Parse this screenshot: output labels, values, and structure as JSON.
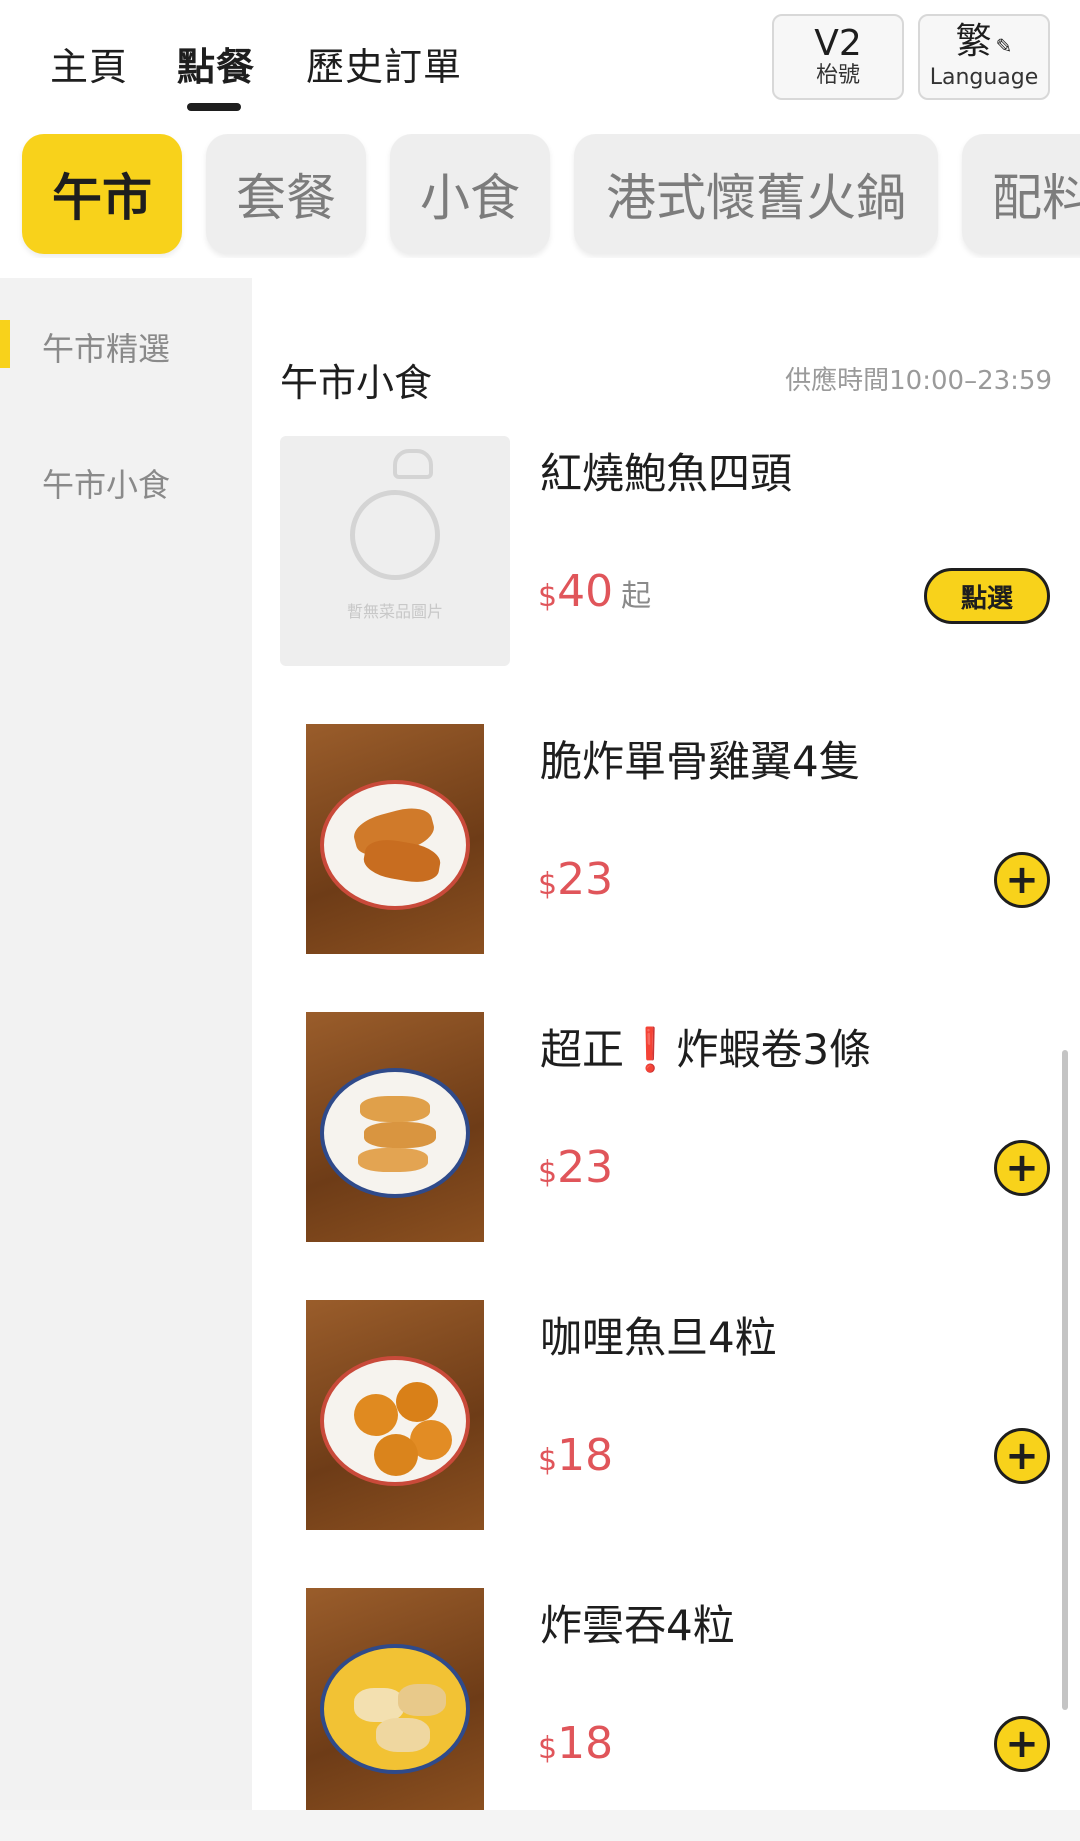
{
  "nav": {
    "tabs": [
      {
        "label": "主頁"
      },
      {
        "label": "點餐"
      },
      {
        "label": "歷史訂單"
      }
    ],
    "table_button": {
      "big": "V2",
      "small": "枱號"
    },
    "language_button": {
      "big": "繁",
      "small": "Language",
      "icon": "pencil-icon"
    }
  },
  "categories": [
    {
      "label": "午市",
      "active": true
    },
    {
      "label": "套餐"
    },
    {
      "label": "小食"
    },
    {
      "label": "港式懷舊火鍋"
    },
    {
      "label": "配料"
    }
  ],
  "sidebar": {
    "items": [
      {
        "label": "午市精選",
        "active": true
      },
      {
        "label": "午市小食"
      }
    ]
  },
  "section": {
    "title": "午市小食",
    "time": "供應時間10:00–23:59"
  },
  "items": [
    {
      "name": "紅燒鮑魚四頭",
      "currency": "$",
      "price": "40",
      "suffix": "起",
      "action": "點選",
      "placeholder_text": "暫無菜品圖片"
    },
    {
      "name": "脆炸單骨雞翼4隻",
      "currency": "$",
      "price": "23",
      "action_icon": "+"
    },
    {
      "name_before": "超正",
      "name_excl": "❗",
      "name_after": "炸蝦卷3條",
      "currency": "$",
      "price": "23",
      "action_icon": "+"
    },
    {
      "name": "咖哩魚旦4粒",
      "currency": "$",
      "price": "18",
      "action_icon": "+"
    },
    {
      "name": "炸雲吞4粒",
      "currency": "$",
      "price": "18",
      "action_icon": "+"
    }
  ],
  "colors": {
    "accent": "#f8d21b",
    "price": "#e0555a",
    "text": "#1e1e1e",
    "muted": "#8a8a8a"
  }
}
